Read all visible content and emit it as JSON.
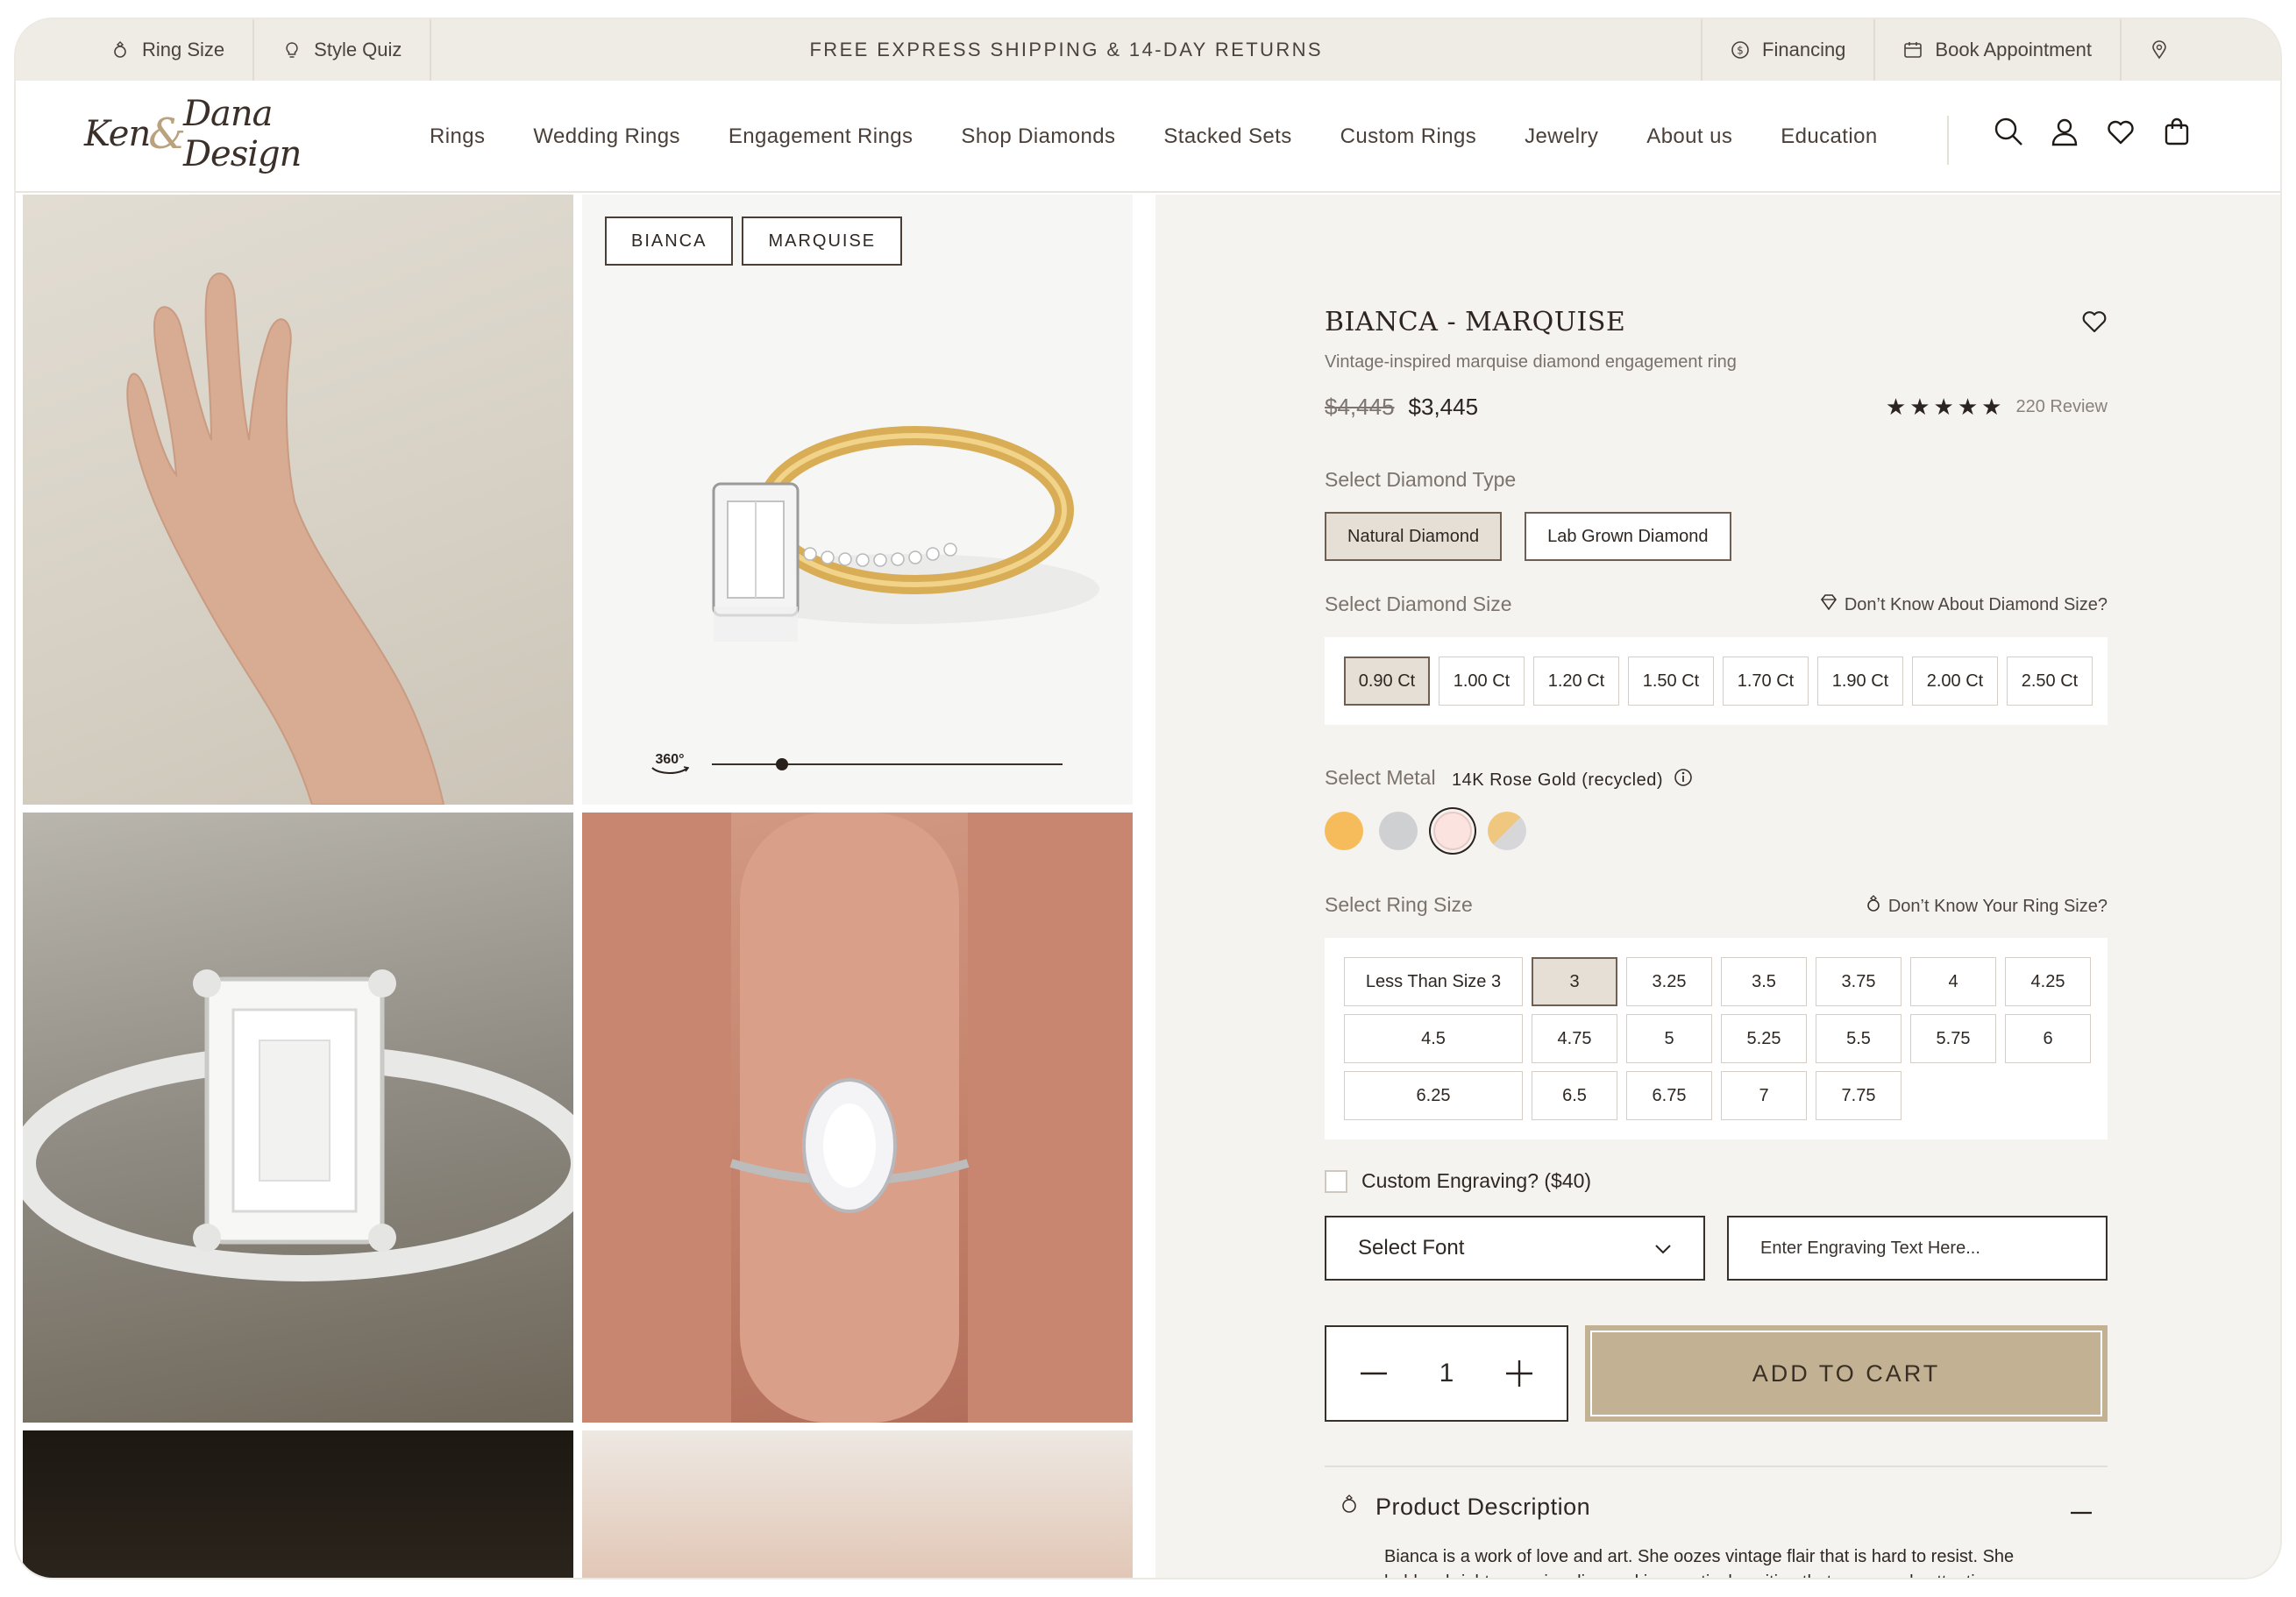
{
  "topbar": {
    "ring_size": "Ring Size",
    "style_quiz": "Style Quiz",
    "promo": "FREE EXPRESS SHIPPING & 14-DAY RETURNS",
    "financing": "Financing",
    "book_appointment": "Book Appointment"
  },
  "brand": {
    "logo_left": "Ken",
    "logo_amp": "&",
    "logo_right": "Dana Design"
  },
  "nav": {
    "items": [
      "Rings",
      "Wedding Rings",
      "Engagement Rings",
      "Shop Diamonds",
      "Stacked Sets",
      "Custom Rings",
      "Jewelry",
      "About us",
      "Education"
    ]
  },
  "gallery": {
    "chips": [
      "BIANCA",
      "MARQUISE"
    ],
    "viewer_label": "360°",
    "rotation_progress": 0.2
  },
  "product": {
    "title": "BIANCA - MARQUISE",
    "subtitle": "Vintage-inspired marquise diamond engagement ring",
    "old_price": "$4,445",
    "price": "$3,445",
    "rating": 5,
    "review_count": "220 Review",
    "diamond_type": {
      "label": "Select Diamond Type",
      "options": [
        "Natural Diamond",
        "Lab Grown Diamond"
      ],
      "selected": "Natural Diamond"
    },
    "diamond_size": {
      "label": "Select Diamond Size",
      "help": "Don’t Know About Diamond Size?",
      "options": [
        "0.90 Ct",
        "1.00 Ct",
        "1.20 Ct",
        "1.50 Ct",
        "1.70 Ct",
        "1.90 Ct",
        "2.00 Ct",
        "2.50 Ct"
      ],
      "selected": "0.90 Ct"
    },
    "metal": {
      "label": "Select Metal",
      "selected_name": "14K Rose Gold (recycled)",
      "swatches": [
        {
          "name": "yellow-gold",
          "color": "#f6bb5b"
        },
        {
          "name": "white-gold",
          "color": "#cfd0d2"
        },
        {
          "name": "rose-gold",
          "color": "#fbe3e0"
        },
        {
          "name": "two-tone",
          "color": "#e6cb9a"
        }
      ],
      "selected_index": 2
    },
    "ring_size": {
      "label": "Select Ring Size",
      "help": "Don’t Know Your Ring Size?",
      "options": [
        "Less Than Size 3",
        "3",
        "3.25",
        "3.5",
        "3.75",
        "4",
        "4.25",
        "4.5",
        "4.75",
        "5",
        "5.25",
        "5.5",
        "5.75",
        "6",
        "6.25",
        "6.5",
        "6.75",
        "7",
        "7.75"
      ],
      "selected": "3"
    },
    "engraving": {
      "label": "Custom Engraving? ($40)",
      "font_select": "Select Font",
      "placeholder": "Enter Engraving Text Here..."
    },
    "quantity": "1",
    "add_to_cart": "ADD TO CART",
    "description": {
      "title": "Product Description",
      "text": "Bianca is a work of love and art. She oozes vintage flair that is hard to resist. She holds a bright marquise diamond in a vertical position that commands attention."
    }
  },
  "colors": {
    "topbar_bg": "#efebe5",
    "panel_bg": "#f5f3ef",
    "accent": "#c2b293",
    "selected_bg": "#e5dfd6",
    "text_dark": "#2e2722"
  }
}
